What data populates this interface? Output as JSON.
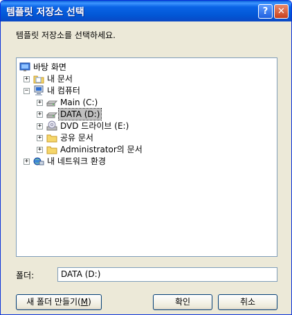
{
  "window": {
    "title": "템플릿 저장소 선택"
  },
  "prompt": "템플릿 저장소를 선택하세요.",
  "tree": {
    "desktop": "바탕 화면",
    "documents": "내 문서",
    "computer": "내 컴퓨터",
    "drive_main": "Main (C:)",
    "drive_data": "DATA (D:)",
    "drive_dvd": "DVD 드라이브 (E:)",
    "shared_docs": "공유 문서",
    "admin_docs": "Administrator의 문서",
    "network": "내 네트워크 환경",
    "selected": "DATA (D:)"
  },
  "folder_label": "폴더:",
  "folder_value": "DATA (D:)",
  "buttons": {
    "new_folder_prefix": "새 폴더 만들기(",
    "new_folder_key": "M",
    "new_folder_suffix": ")",
    "ok": "확인",
    "cancel": "취소"
  },
  "title_buttons": {
    "help": "?",
    "close": "✕"
  },
  "colors": {
    "titlebar": "#0257d6",
    "dialog_bg": "#ece9d8",
    "border": "#7f9db9"
  }
}
